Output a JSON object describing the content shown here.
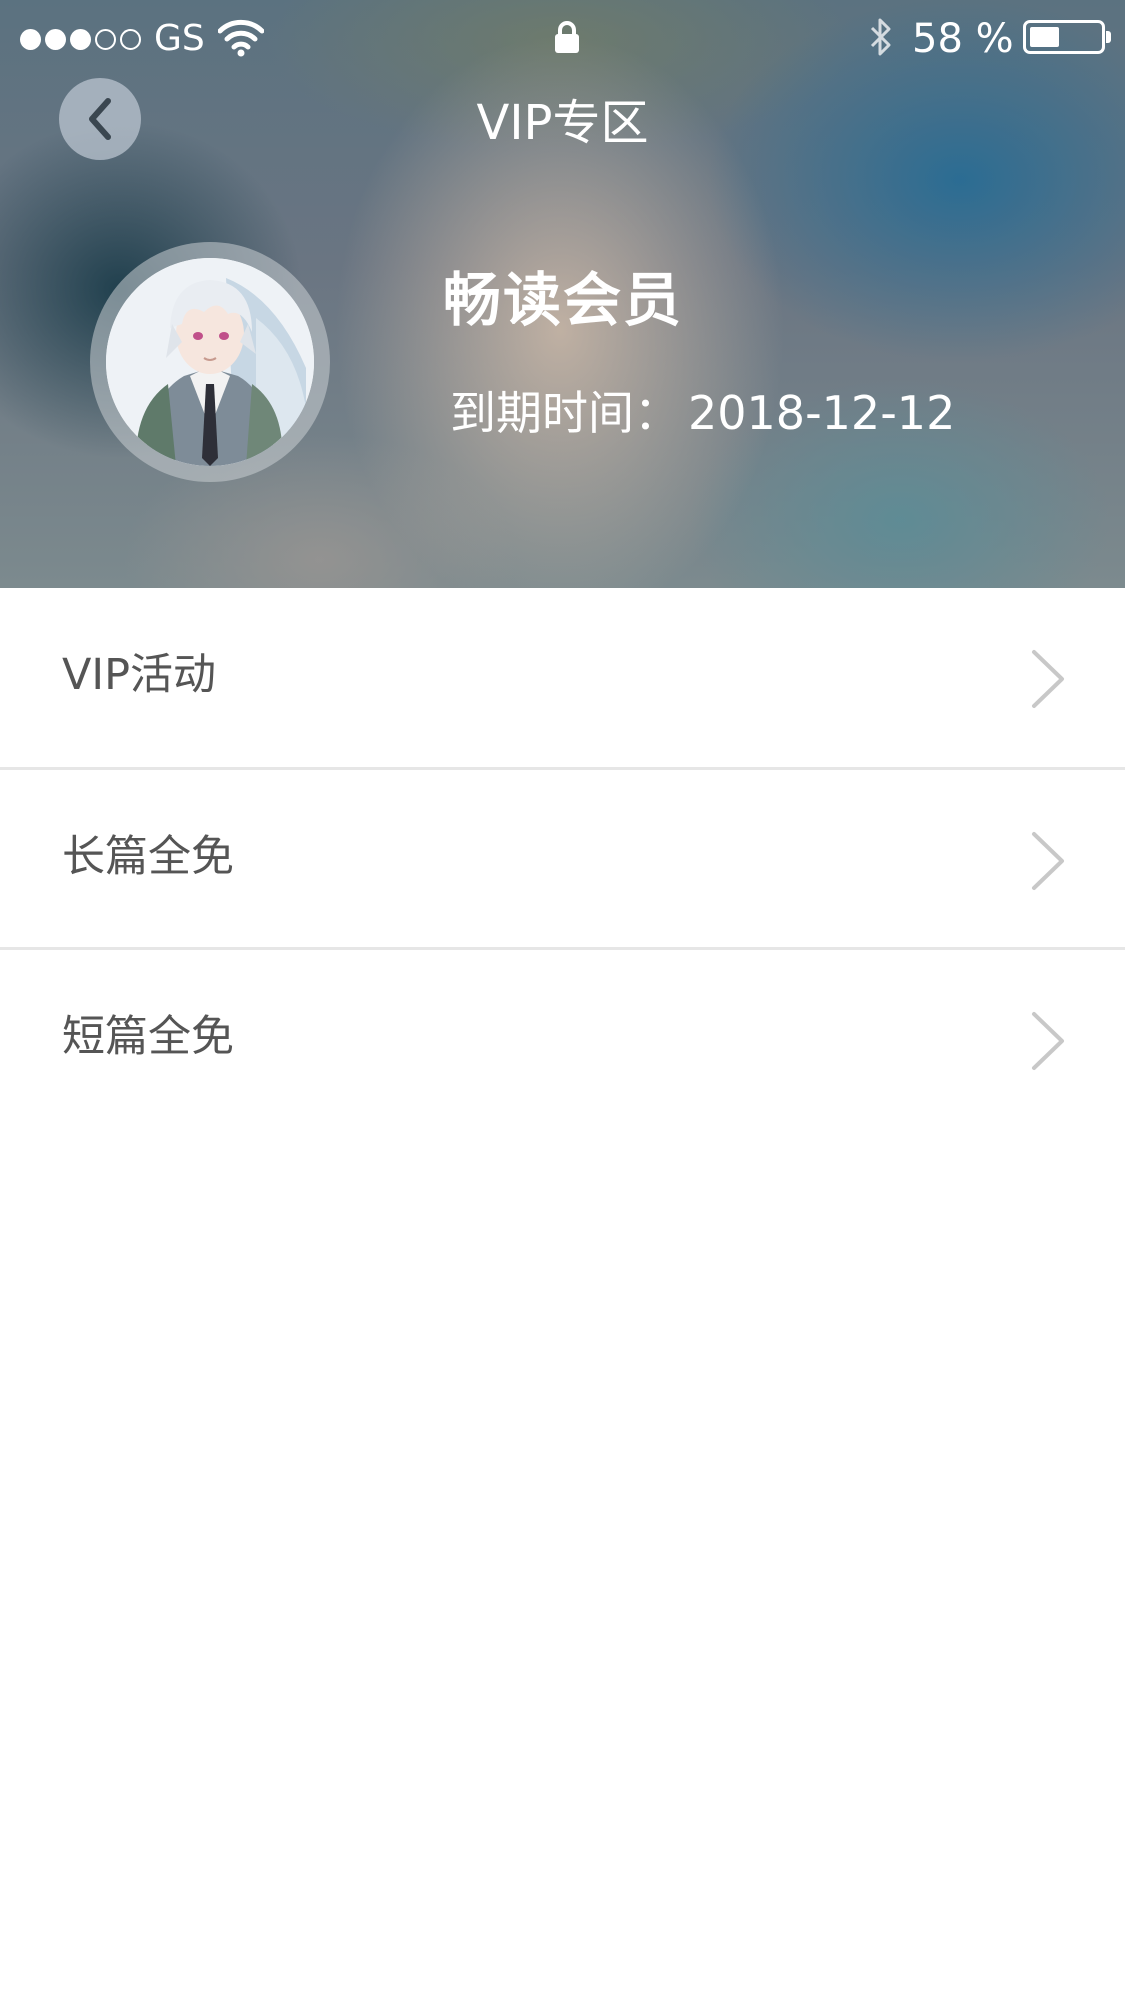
{
  "status_bar": {
    "signal_filled": 3,
    "signal_total": 5,
    "carrier": "GS",
    "wifi_icon": "wifi-icon",
    "lock_icon": "lock-icon",
    "bluetooth_icon": "bluetooth-icon",
    "battery_percent": "58 %",
    "battery_level": 0.38
  },
  "nav": {
    "back_icon": "chevron-left-icon",
    "title": "VIP专区"
  },
  "profile": {
    "avatar_icon": "avatar-image",
    "membership": "畅读会员",
    "expiry_label": "到期时间：",
    "expiry_date": "2018-12-12"
  },
  "menu": {
    "items": [
      {
        "label": "VIP活动",
        "icon": "chevron-right-icon"
      },
      {
        "label": "长篇全免",
        "icon": "chevron-right-icon"
      },
      {
        "label": "短篇全免",
        "icon": "chevron-right-icon"
      }
    ]
  },
  "colors": {
    "header_tint": "#6a7582",
    "text_primary": "#555555",
    "divider": "#e6e6e6",
    "chevron": "#c8c8c8"
  }
}
